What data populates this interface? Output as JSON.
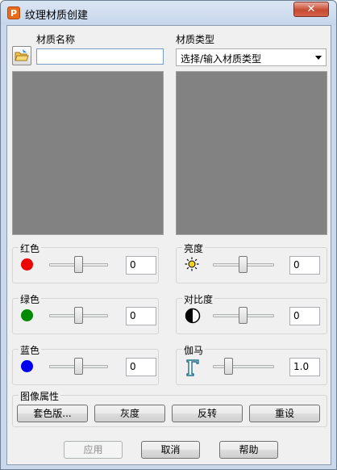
{
  "window": {
    "title": "纹理材质创建",
    "app_icon": "P",
    "close_glyph": "✕"
  },
  "material_name": {
    "label": "材质名称",
    "value": ""
  },
  "material_type": {
    "label": "材质类型",
    "selected": "选择/输入材质类型"
  },
  "color": {
    "red": {
      "label": "红色",
      "value": "0",
      "color": "#ee0000",
      "level": 0.5
    },
    "green": {
      "label": "绿色",
      "value": "0",
      "color": "#008a00",
      "level": 0.5
    },
    "blue": {
      "label": "蓝色",
      "value": "0",
      "color": "#0000ee",
      "level": 0.5
    }
  },
  "adjust": {
    "brightness": {
      "label": "亮度",
      "value": "0",
      "icon": "sun-icon",
      "level": 0.5
    },
    "contrast": {
      "label": "对比度",
      "value": "0",
      "icon": "contrast-icon",
      "level": 0.5
    },
    "gamma": {
      "label": "伽马",
      "value": "1.0",
      "icon": "gamma-icon",
      "level": 0.25
    }
  },
  "image_props": {
    "label": "图像属性",
    "buttons": [
      "套色版...",
      "灰度",
      "反转",
      "重设"
    ]
  },
  "footer": {
    "apply": "应用",
    "cancel": "取消",
    "help": "帮助"
  },
  "colors": {
    "preview_bg": "#828282",
    "frame": "#c9d8eb",
    "close": "#c74a32"
  }
}
